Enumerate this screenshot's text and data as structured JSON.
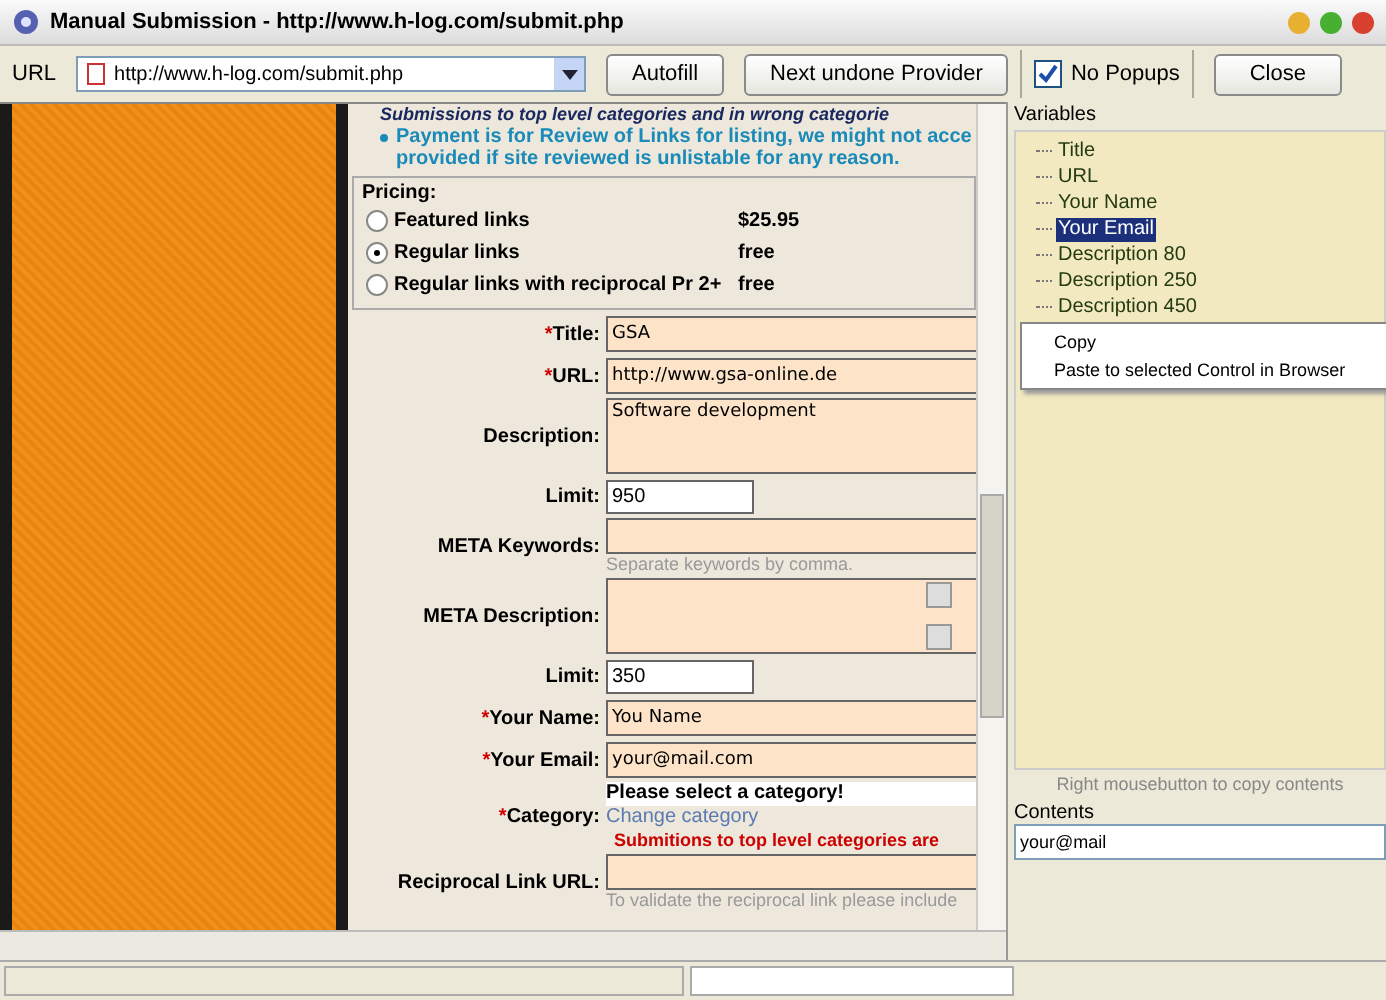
{
  "window": {
    "title": "Manual Submission - http://www.h-log.com/submit.php"
  },
  "toolbar": {
    "url_label": "URL",
    "url_value": "http://www.h-log.com/submit.php",
    "buttons": [
      "Autofill",
      "Next undone Provider"
    ],
    "popups": {
      "label": "No Popups",
      "checked": true
    },
    "close": "Close"
  },
  "page": {
    "notices": [
      {
        "kind": "cut",
        "text": "Submissions to top level categories and in wrong categorie"
      },
      {
        "kind": "bullet",
        "text": "Payment is for Review of Links for listing, we might not acce provided if site reviewed is unlistable for any reason."
      }
    ],
    "pricing": {
      "title": "Pricing:",
      "options": [
        {
          "label": "Featured links",
          "price": "$25.95",
          "selected": false
        },
        {
          "label": "Regular links",
          "price": "free",
          "selected": true
        },
        {
          "label": "Regular links with reciprocal Pr 2+",
          "price": "free",
          "selected": false
        }
      ]
    },
    "fields": [
      {
        "kind": "input",
        "mark": "*",
        "label": "Title:",
        "value": "GSA"
      },
      {
        "kind": "input",
        "mark": "*",
        "label": "URL:",
        "value": "http://www.gsa-online.de"
      },
      {
        "kind": "textarea",
        "label": "Description:",
        "value": "Software development"
      },
      {
        "kind": "limit",
        "label": "Limit:",
        "value": "950"
      },
      {
        "kind": "input",
        "label": "META Keywords:",
        "hint": "Separate keywords by comma."
      },
      {
        "kind": "textarea",
        "label": "META Description:",
        "scroll": true
      },
      {
        "kind": "limit",
        "label": "Limit:",
        "value": "350"
      },
      {
        "kind": "input",
        "mark": "*",
        "label": "Your Name:",
        "value": "You Name"
      },
      {
        "kind": "input",
        "mark": "*",
        "label": "Your Email:",
        "value": "your@mail.com"
      },
      {
        "kind": "category",
        "mark": "*",
        "label": "Category:",
        "prompt": "Please select a category!",
        "link": "Change category",
        "warning": "Submitions to top level categories are"
      },
      {
        "kind": "input",
        "label": "Reciprocal Link URL:",
        "hint": "To validate the reciprocal link please include"
      }
    ]
  },
  "variables": {
    "title": "Variables",
    "items": [
      {
        "label": "Title",
        "selected": false
      },
      {
        "label": "URL",
        "selected": false
      },
      {
        "label": "Your Name",
        "selected": false
      },
      {
        "label": "Your Email",
        "selected": true
      },
      {
        "label": "Description 80",
        "selected": false
      },
      {
        "label": "Description 250",
        "selected": false
      },
      {
        "label": "Description 450",
        "selected": false
      }
    ],
    "context_menu": [
      "Copy",
      "Paste to selected Control in Browser"
    ],
    "hint": "Right mousebutton to copy contents",
    "contents_label": "Contents",
    "contents_value": "your@mail"
  }
}
